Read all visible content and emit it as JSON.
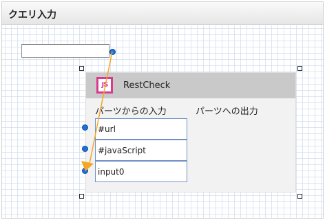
{
  "header": {
    "title": "クエリ入力"
  },
  "query_input": {
    "value": "",
    "placeholder": ""
  },
  "node": {
    "title": "RestCheck",
    "logo_text": "JS",
    "inputs_label": "パーツからの入力",
    "outputs_label": "パーツへの出力",
    "inputs": [
      {
        "label": "#url"
      },
      {
        "label": "#javaScript"
      },
      {
        "label": "input0"
      }
    ]
  },
  "colors": {
    "connection": "#f5a623",
    "port": "#1f6fd6",
    "logo": "#d93a8f",
    "input_border": "#6e8fc4"
  },
  "icons": {
    "logo": "restcheck-js-logo-icon",
    "port": "blue-dot",
    "handle": "square-resize-handle"
  }
}
